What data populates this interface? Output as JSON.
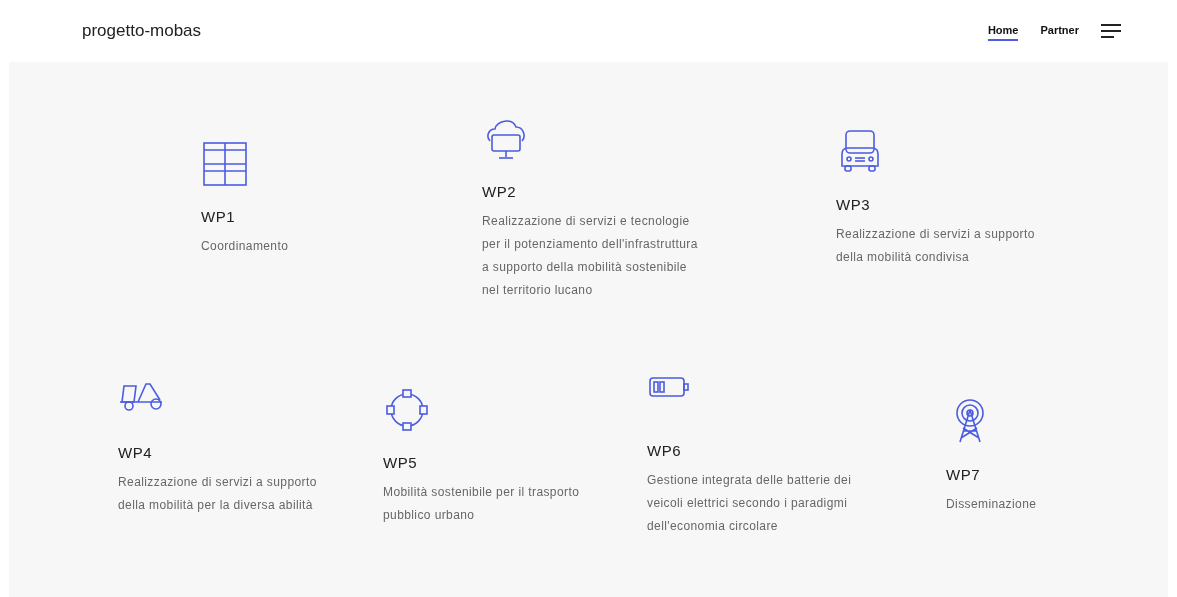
{
  "header": {
    "site_title": "progetto-mobas",
    "nav": [
      {
        "label": "Home",
        "selected": true
      },
      {
        "label": "Partner",
        "selected": false
      }
    ]
  },
  "rows": [
    [
      {
        "kind": "grid",
        "title": "WP1",
        "description": "Coordinamento"
      },
      {
        "kind": "cloud-monitor",
        "title": "WP2",
        "description": "Realizzazione di servizi e tecnologie per il potenziamento dell'infrastruttura a supporto della mobilità sostenibile nel territorio lucano"
      },
      {
        "kind": "car",
        "title": "WP3",
        "description": "Realizzazione di servizi a supporto della mobilità condivisa"
      }
    ],
    [
      {
        "kind": "scooter",
        "title": "WP4",
        "description": "Realizzazione di servizi a supporto della mobilità per la diversa abilità"
      },
      {
        "kind": "nodes",
        "title": "WP5",
        "description": "Mobilità sostenibile per il trasporto pubblico urbano"
      },
      {
        "kind": "battery",
        "title": "WP6",
        "description": "Gestione integrata delle batterie dei veicoli elettrici secondo i paradigmi dell'economia circolare"
      },
      {
        "kind": "antenna",
        "title": "WP7",
        "description": "Disseminazione"
      }
    ]
  ]
}
